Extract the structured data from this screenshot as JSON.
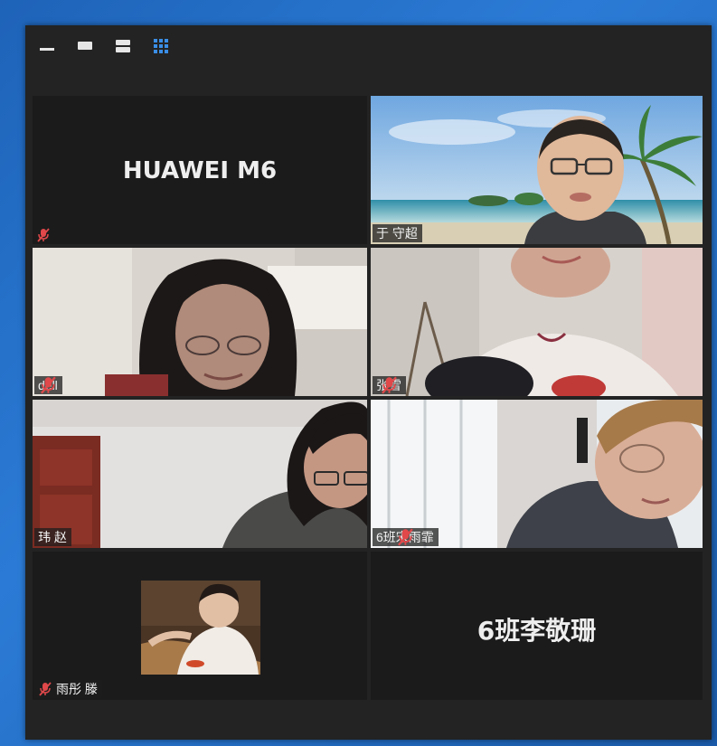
{
  "toolbar": {
    "icons": [
      "minimize-icon",
      "single-view-icon",
      "split-view-icon",
      "grid-view-icon"
    ],
    "active_color": "#3a8ee6"
  },
  "participants": [
    {
      "id": "p1",
      "name": "",
      "display_label": "HUAWEI M6",
      "muted": true,
      "video": false
    },
    {
      "id": "p2",
      "name": "于 守超",
      "muted": false,
      "video": true
    },
    {
      "id": "p3",
      "name": "dell",
      "muted": true,
      "video": true,
      "active_speaker": true
    },
    {
      "id": "p4",
      "name": "张雪",
      "muted": true,
      "video": true
    },
    {
      "id": "p5",
      "name": "玮 赵",
      "muted": false,
      "video": true
    },
    {
      "id": "p6",
      "name": "6班宋雨霏",
      "muted": true,
      "video": true
    },
    {
      "id": "p7",
      "name": "雨彤 滕",
      "muted": true,
      "video": false,
      "avatar": true
    },
    {
      "id": "p8",
      "name": "",
      "display_label": "6班李敬珊",
      "muted": false,
      "video": false
    }
  ],
  "colors": {
    "mute_icon": "#e0484a",
    "active_border": "#d6e88a",
    "window_bg": "#232323"
  }
}
